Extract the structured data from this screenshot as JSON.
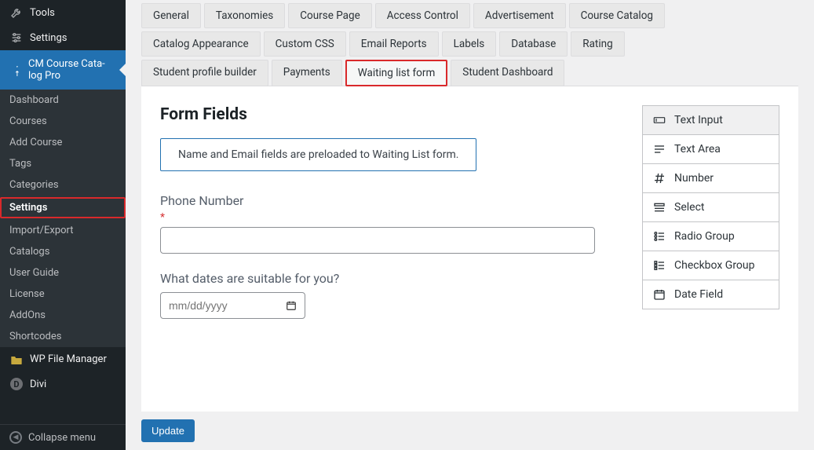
{
  "sidebar": {
    "top": [
      {
        "icon": "wrench",
        "label": "Tools"
      },
      {
        "icon": "sliders",
        "label": "Settings"
      }
    ],
    "activeParent": {
      "icon": "pin",
      "label": "CM Course Cata­log Pro"
    },
    "submenu": [
      "Dashboard",
      "Courses",
      "Add Course",
      "Tags",
      "Categories",
      "Settings",
      "Import/Export",
      "Catalogs",
      "User Guide",
      "License",
      "AddOns",
      "Shortcodes"
    ],
    "bottom": [
      {
        "icon": "folder",
        "label": "WP File Manager"
      },
      {
        "icon": "d",
        "label": "Divi"
      }
    ],
    "collapse": "Collapse menu"
  },
  "tabs": {
    "row1": [
      "General",
      "Taxonomies",
      "Course Page",
      "Access Control",
      "Advertisement",
      "Course Catalog"
    ],
    "row2": [
      "Catalog Appearance",
      "Custom CSS",
      "Email Reports",
      "Labels",
      "Database",
      "Rating"
    ],
    "row3": [
      "Student profile builder",
      "Payments",
      "Waiting list form",
      "Student Dashboard"
    ]
  },
  "content": {
    "heading": "Form Fields",
    "info": "Name and Email fields are preloaded to Waiting List form.",
    "fields": [
      {
        "label": "Phone Number",
        "required": true,
        "type": "text"
      },
      {
        "label": "What dates are suitable for you?",
        "required": false,
        "type": "date",
        "placeholder": "mm/dd/yyyy"
      }
    ]
  },
  "palette": [
    {
      "icon": "text",
      "label": "Text Input"
    },
    {
      "icon": "lines",
      "label": "Text Area"
    },
    {
      "icon": "hash",
      "label": "Number"
    },
    {
      "icon": "list",
      "label": "Select"
    },
    {
      "icon": "radio",
      "label": "Radio Group"
    },
    {
      "icon": "check",
      "label": "Checkbox Group"
    },
    {
      "icon": "cal",
      "label": "Date Field"
    }
  ],
  "buttons": {
    "update": "Update"
  }
}
